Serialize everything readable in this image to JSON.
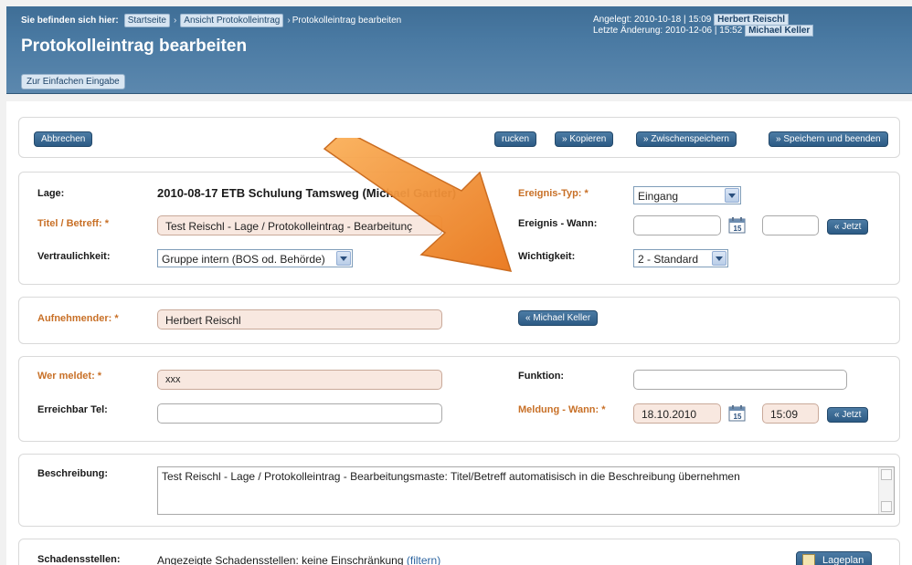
{
  "breadcrumb": {
    "prefix": "Sie befinden sich hier:",
    "items": [
      "Startseite",
      "Ansicht Protokolleintrag"
    ],
    "current": "Protokolleintrag bearbeiten"
  },
  "title": "Protokolleintrag bearbeiten",
  "simple_entry_label": "Zur Einfachen Eingabe",
  "meta": {
    "created_label": "Angelegt: 2010-10-18 | 15:09",
    "created_by": "Herbert Reischl",
    "changed_label": "Letzte Änderung: 2010-12-06 | 15:52",
    "changed_by": "Michael Keller"
  },
  "toolbar": {
    "cancel": "Abbrechen",
    "print": "rucken",
    "copy": "» Kopieren",
    "save_draft": "» Zwischenspeichern",
    "save_exit": "» Speichern und beenden"
  },
  "form1": {
    "lage_label": "Lage:",
    "lage_value": "2010-08-17 ETB Schulung Tamsweg (Michael Gartler)",
    "titel_label": "Titel / Betreff: *",
    "titel_value": "Test Reischl - Lage / Protokolleintrag - Bearbeitunç",
    "vertr_label": "Vertraulichkeit:",
    "vertr_value": "Gruppe intern (BOS od. Behörde)",
    "typ_label": "Ereignis-Typ: *",
    "typ_value": "Eingang",
    "wann_label": "Ereignis - Wann:",
    "wann_date": "",
    "wann_time": "",
    "now_label": "« Jetzt",
    "wicht_label": "Wichtigkeit:",
    "wicht_value": "2 - Standard"
  },
  "form2": {
    "aufn_label": "Aufnehmender: *",
    "aufn_value": "Herbert  Reischl",
    "aufn_btn": "« Michael Keller"
  },
  "form3": {
    "wer_label": "Wer meldet: *",
    "wer_value": "xxx",
    "tel_label": "Erreichbar Tel:",
    "tel_value": "",
    "funk_label": "Funktion:",
    "funk_value": "",
    "meld_label": "Meldung - Wann: *",
    "meld_date": "18.10.2010",
    "meld_time": "15:09",
    "now_label": "« Jetzt"
  },
  "form4": {
    "beschr_label": "Beschreibung:",
    "beschr_value": "Test Reischl - Lage / Protokolleintrag - Bearbeitungsmaste: Titel/Betreff automatisisch in die Beschreibung übernehmen"
  },
  "form5": {
    "label": "Schadensstellen:",
    "text": "Angezeigte Schadensstellen: keine Einschränkung",
    "filter_link": "(filtern)",
    "lageplan": "Lageplan"
  },
  "calendar_day": "15",
  "colors": {
    "header": "#4a7aa3",
    "button": "#2c5b85",
    "required_label": "#c87027",
    "required_field": "#f8e8e0",
    "arrow": "#f08a24"
  },
  "icons": [
    "calendar-icon",
    "dropdown-arrow-icon",
    "orange-arrow-annotation",
    "lageplan-icon"
  ]
}
